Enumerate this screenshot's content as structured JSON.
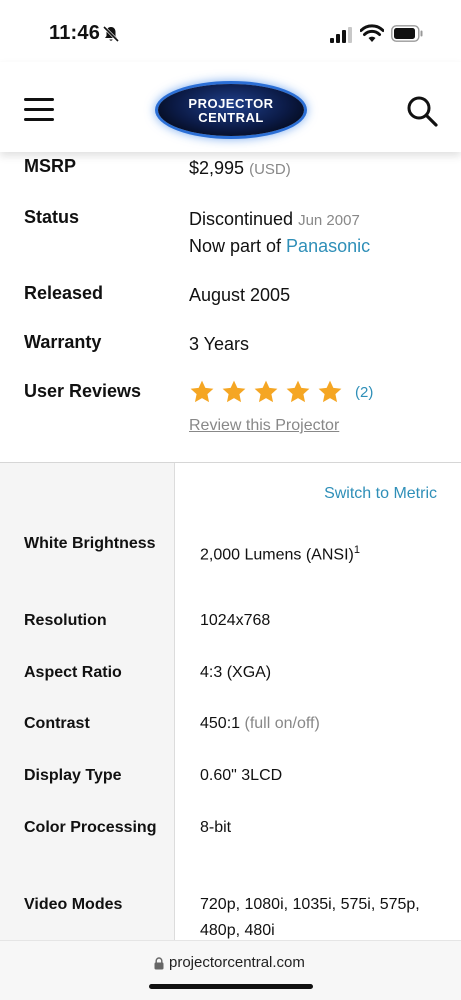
{
  "status_bar": {
    "time": "11:46"
  },
  "header": {
    "logo_line1": "PROJECTOR",
    "logo_line2": "CENTRAL"
  },
  "summary": {
    "msrp_label": "MSRP",
    "msrp_value": "$2,995",
    "msrp_currency": "(USD)",
    "status_label": "Status",
    "status_value": "Discontinued",
    "status_date": "Jun 2007",
    "status_line2_prefix": "Now part of ",
    "status_line2_link": "Panasonic",
    "released_label": "Released",
    "released_value": "August 2005",
    "warranty_label": "Warranty",
    "warranty_value": "3 Years",
    "reviews_label": "User Reviews",
    "rating_stars": 5,
    "reviews_count": "(2)",
    "review_link": "Review this Projector"
  },
  "specs": {
    "switch_metric": "Switch to Metric",
    "rows": [
      {
        "label": "White Brightness",
        "value": "2,000 Lumens (ANSI)",
        "sup": "1"
      },
      {
        "label": "Resolution",
        "value": "1024x768"
      },
      {
        "label": "Aspect Ratio",
        "value": "4:3 (XGA)"
      },
      {
        "label": "Contrast",
        "value": "450:1",
        "note": "(full on/off)"
      },
      {
        "label": "Display Type",
        "value": "0.60\" 3LCD"
      },
      {
        "label": "Color Processing",
        "value": "8-bit"
      },
      {
        "label": "Video Modes",
        "value": "720p, 1080i, 1035i, 575i, 575p, 480p, 480i"
      }
    ]
  },
  "browser": {
    "url": "projectorcentral.com"
  },
  "colors": {
    "link": "#2f8fb8",
    "star": "#f5a623",
    "table_label_bg": "#f5f5f5"
  }
}
